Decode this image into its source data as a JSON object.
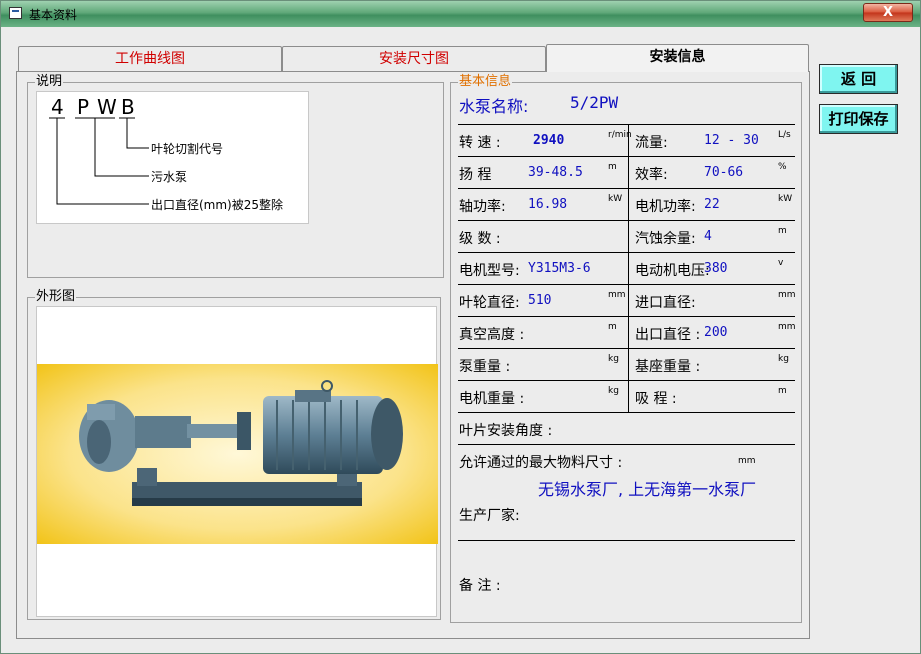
{
  "window": {
    "title": "基本资料",
    "close_label": "X"
  },
  "tabs": [
    {
      "label": "工作曲线图",
      "color": "#d00000"
    },
    {
      "label": "安装尺寸图",
      "color": "#d00000"
    },
    {
      "label": "安装信息",
      "selected": true
    }
  ],
  "sidebar_buttons": {
    "back": "返 回",
    "print_save": "打印保存"
  },
  "explain": {
    "group_label": "说明",
    "code_letters": [
      "4",
      "P",
      "W",
      "B"
    ],
    "legend": [
      "叶轮切割代号",
      "污水泵",
      "出口直径(mm)被25整除"
    ]
  },
  "appearance": {
    "group_label": "外形图"
  },
  "info": {
    "group_label": "基本信息",
    "pump_name_label": "水泵名称:",
    "pump_name_value": "5/2PW",
    "rows": [
      {
        "l_label": "转 速 :",
        "l_value": "2940",
        "l_unit": "r/min",
        "r_label": "流量:",
        "r_value": "12 - 30",
        "r_unit": "L/s"
      },
      {
        "l_label": "扬 程",
        "l_value": "39-48.5",
        "l_unit": "m",
        "r_label": "效率:",
        "r_value": "70-66",
        "r_unit": "%"
      },
      {
        "l_label": "轴功率:",
        "l_value": "16.98",
        "l_unit": "kW",
        "r_label": "电机功率:",
        "r_value": "22",
        "r_unit": "kW"
      },
      {
        "l_label": "级 数 :",
        "l_value": "",
        "l_unit": "",
        "r_label": "汽蚀余量:",
        "r_value": "4",
        "r_unit": "m"
      },
      {
        "l_label": "电机型号:",
        "l_value": "Y315M3-6",
        "l_unit": "",
        "r_label": "电动机电压:",
        "r_value": "380",
        "r_unit": "v"
      },
      {
        "l_label": "叶轮直径:",
        "l_value": "510",
        "l_unit": "mm",
        "r_label": "进口直径:",
        "r_value": "",
        "r_unit": "mm"
      },
      {
        "l_label": "真空高度 :",
        "l_value": "",
        "l_unit": "m",
        "r_label": "出口直径 :",
        "r_value": "200",
        "r_unit": "mm"
      },
      {
        "l_label": "泵重量 :",
        "l_value": "",
        "l_unit": "kg",
        "r_label": "基座重量 :",
        "r_value": "",
        "r_unit": "kg"
      },
      {
        "l_label": "电机重量 :",
        "l_value": "",
        "l_unit": "kg",
        "r_label": "吸 程 :",
        "r_value": "",
        "r_unit": "m"
      }
    ],
    "blade_angle_label": "叶片安装角度 :",
    "max_particle_label": "允许通过的最大物料尺寸 :",
    "max_particle_unit": "mm",
    "manufacturer_label": "生产厂家:",
    "manufacturer_value": "无锡水泵厂, 上无海第一水泵厂",
    "remarks_label": "备  注 :"
  }
}
